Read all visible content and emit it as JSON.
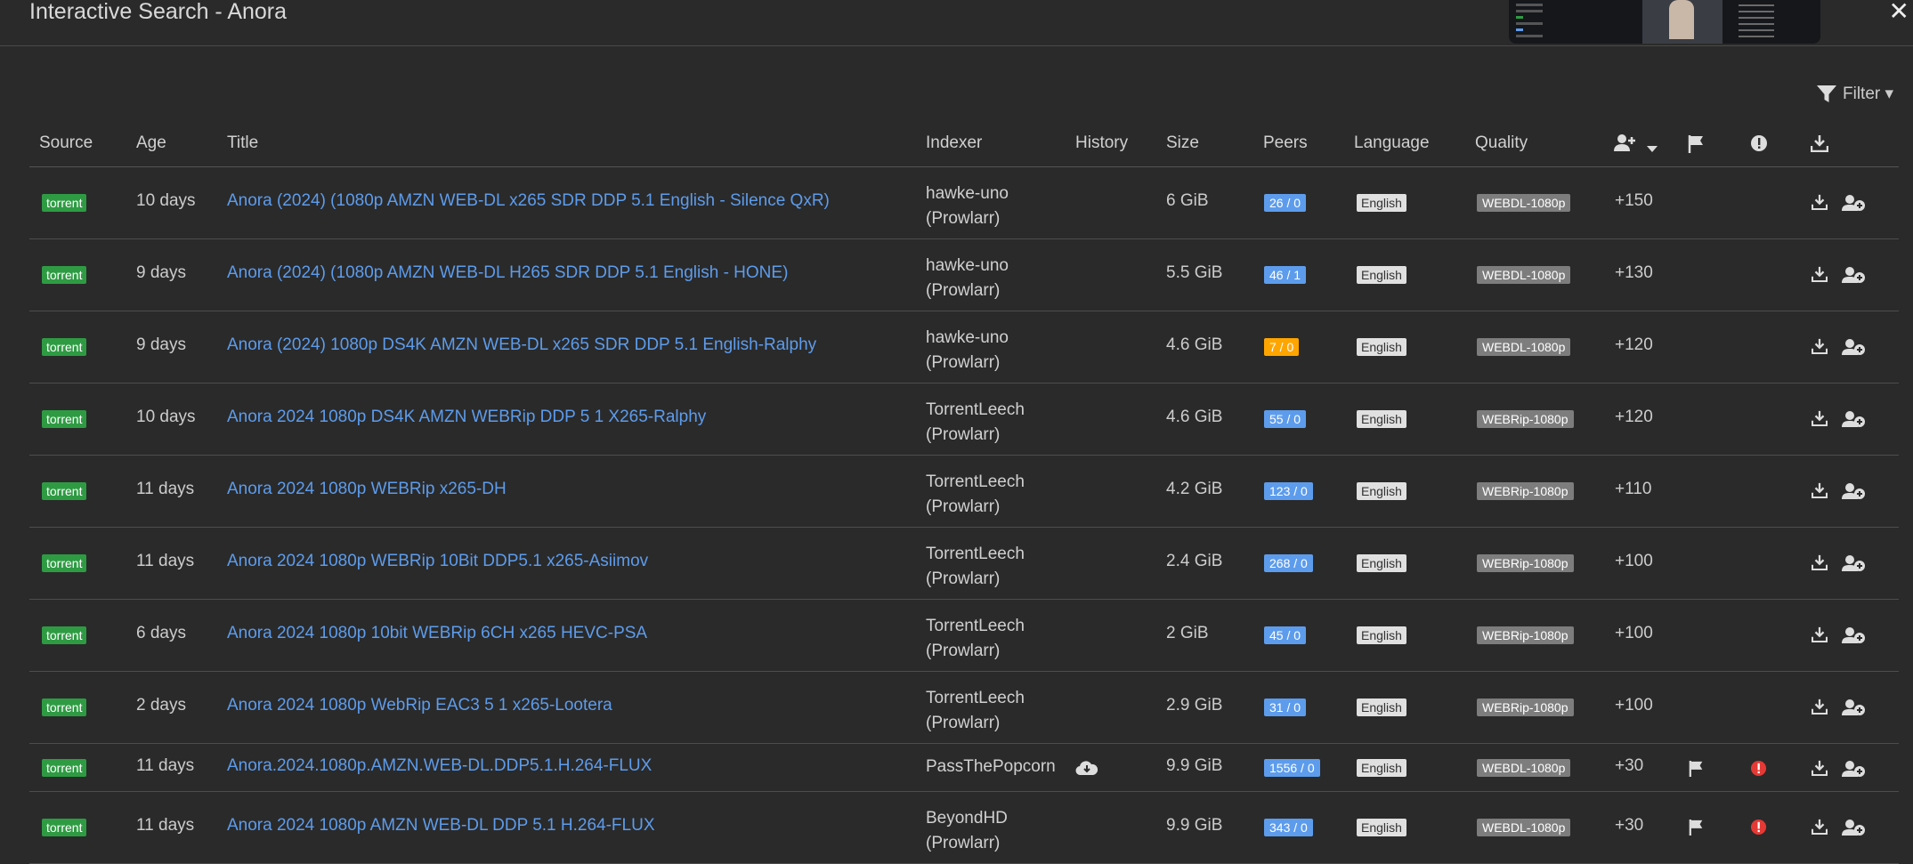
{
  "dialog": {
    "title": "Interactive Search - Anora",
    "close_label": "✕",
    "filter_label": "Filter ▾"
  },
  "columns": [
    "Source",
    "Age",
    "Title",
    "Indexer",
    "History",
    "Size",
    "Peers",
    "Language",
    "Quality"
  ],
  "rows": [
    {
      "source": "torrent",
      "age": "10 days",
      "title": "Anora (2024) (1080p AMZN WEB-DL x265 SDR DDP 5.1 English - Silence QxR)",
      "indexer1": "hawke-uno",
      "indexer2": "(Prowlarr)",
      "size": "6 GiB",
      "peers": "26 / 0",
      "language": "English",
      "quality": "WEBDL-1080p",
      "score": "+150"
    },
    {
      "source": "torrent",
      "age": "9 days",
      "title": "Anora (2024) (1080p AMZN WEB-DL H265 SDR DDP 5.1 English - HONE)",
      "indexer1": "hawke-uno",
      "indexer2": "(Prowlarr)",
      "size": "5.5 GiB",
      "peers": "46 / 1",
      "language": "English",
      "quality": "WEBDL-1080p",
      "score": "+130"
    },
    {
      "source": "torrent",
      "age": "9 days",
      "title": "Anora (2024) 1080p DS4K AMZN WEB-DL x265 SDR DDP 5.1 English-Ralphy",
      "indexer1": "hawke-uno",
      "indexer2": "(Prowlarr)",
      "size": "4.6 GiB",
      "peers": "7 / 0",
      "language": "English",
      "quality": "WEBDL-1080p",
      "score": "+120"
    },
    {
      "source": "torrent",
      "age": "10 days",
      "title": "Anora 2024 1080p DS4K AMZN WEBRip DDP 5 1 X265-Ralphy",
      "indexer1": "TorrentLeech",
      "indexer2": "(Prowlarr)",
      "size": "4.6 GiB",
      "peers": "55 / 0",
      "language": "English",
      "quality": "WEBRip-1080p",
      "score": "+120"
    },
    {
      "source": "torrent",
      "age": "11 days",
      "title": "Anora 2024 1080p WEBRip x265-DH",
      "indexer1": "TorrentLeech",
      "indexer2": "(Prowlarr)",
      "size": "4.2 GiB",
      "peers": "123 / 0",
      "language": "English",
      "quality": "WEBRip-1080p",
      "score": "+110"
    },
    {
      "source": "torrent",
      "age": "11 days",
      "title": "Anora 2024 1080p WEBRip 10Bit DDP5.1 x265-Asiimov",
      "indexer1": "TorrentLeech",
      "indexer2": "(Prowlarr)",
      "size": "2.4 GiB",
      "peers": "268 / 0",
      "language": "English",
      "quality": "WEBRip-1080p",
      "score": "+100"
    },
    {
      "source": "torrent",
      "age": "6 days",
      "title": "Anora 2024 1080p 10bit WEBRip 6CH x265 HEVC-PSA",
      "indexer1": "TorrentLeech",
      "indexer2": "(Prowlarr)",
      "size": "2 GiB",
      "peers": "45 / 0",
      "language": "English",
      "quality": "WEBRip-1080p",
      "score": "+100"
    },
    {
      "source": "torrent",
      "age": "2 days",
      "title": "Anora 2024 1080p WebRip EAC3 5 1 x265-Lootera",
      "indexer1": "TorrentLeech",
      "indexer2": "(Prowlarr)",
      "size": "2.9 GiB",
      "peers": "31 / 0",
      "language": "English",
      "quality": "WEBRip-1080p",
      "score": "+100"
    },
    {
      "source": "torrent",
      "age": "11 days",
      "title": "Anora.2024.1080p.AMZN.WEB-DL.DDP5.1.H.264-FLUX",
      "indexer1": "PassThePopcorn",
      "indexer2": "",
      "size": "9.9 GiB",
      "peers": "1556 / 0",
      "language": "English",
      "quality": "WEBDL-1080p",
      "score": "+30"
    },
    {
      "source": "torrent",
      "age": "11 days",
      "title": "Anora 2024 1080p AMZN WEB-DL DDP 5.1 H.264-FLUX",
      "indexer1": "BeyondHD",
      "indexer2": "(Prowlarr)",
      "size": "9.9 GiB",
      "peers": "343 / 0",
      "language": "English",
      "quality": "WEBDL-1080p",
      "score": "+30"
    }
  ],
  "colors": {
    "link": "#5d9cec",
    "source_badge": "#2e9b43",
    "peers_ok": "#5d9cec",
    "peers_warn": "#ffa500",
    "rejection": "#e53935"
  },
  "icons": [
    "filter-icon",
    "add-user-icon",
    "sort-down-icon",
    "flag-icon",
    "exclamation-icon",
    "download-icon",
    "cloud-download-icon",
    "close-icon"
  ]
}
